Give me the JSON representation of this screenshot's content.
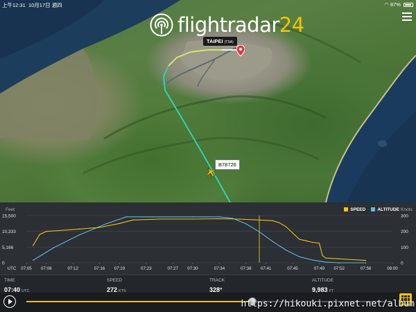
{
  "status_bar": {
    "time": "上午12:31",
    "date": "10月17日 週四",
    "battery": "87%"
  },
  "logo": {
    "text": "flightradar",
    "number": "24"
  },
  "map": {
    "airport_label": "TAIPEI",
    "airport_code": "(TSA)",
    "flight_label": "B78726",
    "colors": {
      "track_climb": "#2ed3b0",
      "track_approach": "#cfe86a",
      "track_final": "#f4f4f4"
    }
  },
  "chart": {
    "y_unit_left": "Feet",
    "y_unit_right": "Knots",
    "left_ticks": [
      "15,500",
      "10,333",
      "5,166",
      "0"
    ],
    "right_ticks": [
      "300",
      "200",
      "100",
      "0"
    ],
    "x_ticks": [
      "UTC",
      "07:05",
      "07:08",
      "07:12",
      "07:16",
      "07:19",
      "07:23",
      "07:27",
      "07:30",
      "07:34",
      "07:38",
      "07:41",
      "07:45",
      "07:49",
      "07:52",
      "07:56",
      "08:00"
    ],
    "legend_speed": "SPEED",
    "legend_altitude": "ALTITUDE"
  },
  "chart_data": {
    "type": "line",
    "xlabel": "",
    "ylabel_left": "Feet",
    "ylabel_right": "Knots",
    "xlim": [
      "07:05",
      "08:00"
    ],
    "ylim_left": [
      0,
      15500
    ],
    "ylim_right": [
      0,
      300
    ],
    "cursor_time": "07:40",
    "series": [
      {
        "name": "ALTITUDE",
        "axis": "left",
        "color": "#5fb8e8",
        "x": [
          "07:06",
          "07:09",
          "07:13",
          "07:17",
          "07:20",
          "07:24",
          "07:30",
          "07:34",
          "07:36",
          "07:38",
          "07:40",
          "07:42",
          "07:44",
          "07:46",
          "07:48",
          "07:50",
          "07:52",
          "07:56"
        ],
        "y": [
          800,
          4800,
          9200,
          12800,
          15100,
          15100,
          15100,
          15100,
          14600,
          12800,
          10200,
          7000,
          4200,
          2000,
          900,
          200,
          0,
          0
        ]
      },
      {
        "name": "SPEED",
        "axis": "right",
        "color": "#f2c318",
        "x": [
          "07:06",
          "07:07",
          "07:08",
          "07:10",
          "07:13",
          "07:16",
          "07:19",
          "07:21",
          "07:25",
          "07:30",
          "07:34",
          "07:37",
          "07:40",
          "07:42",
          "07:43",
          "07:44",
          "07:45",
          "07:46",
          "07:47",
          "07:48",
          "07:49",
          "07:49.5",
          "07:50",
          "07:52",
          "07:54",
          "07:56"
        ],
        "y": [
          110,
          180,
          200,
          205,
          215,
          225,
          250,
          272,
          278,
          278,
          280,
          278,
          272,
          268,
          255,
          230,
          190,
          150,
          140,
          130,
          125,
          45,
          30,
          25,
          20,
          15
        ]
      }
    ]
  },
  "info": {
    "time": {
      "label": "TIME",
      "value": "07:40",
      "unit": "UTC"
    },
    "speed": {
      "label": "SPEED",
      "value": "272",
      "unit": "KTS"
    },
    "track": {
      "label": "TRACK",
      "value": "328°"
    },
    "altitude": {
      "label": "ALTITUDE",
      "value": "9,983",
      "unit": "FT"
    }
  },
  "playback": {
    "progress": 0.62
  },
  "watermark": "https://hikouki.pixnet.net/album"
}
